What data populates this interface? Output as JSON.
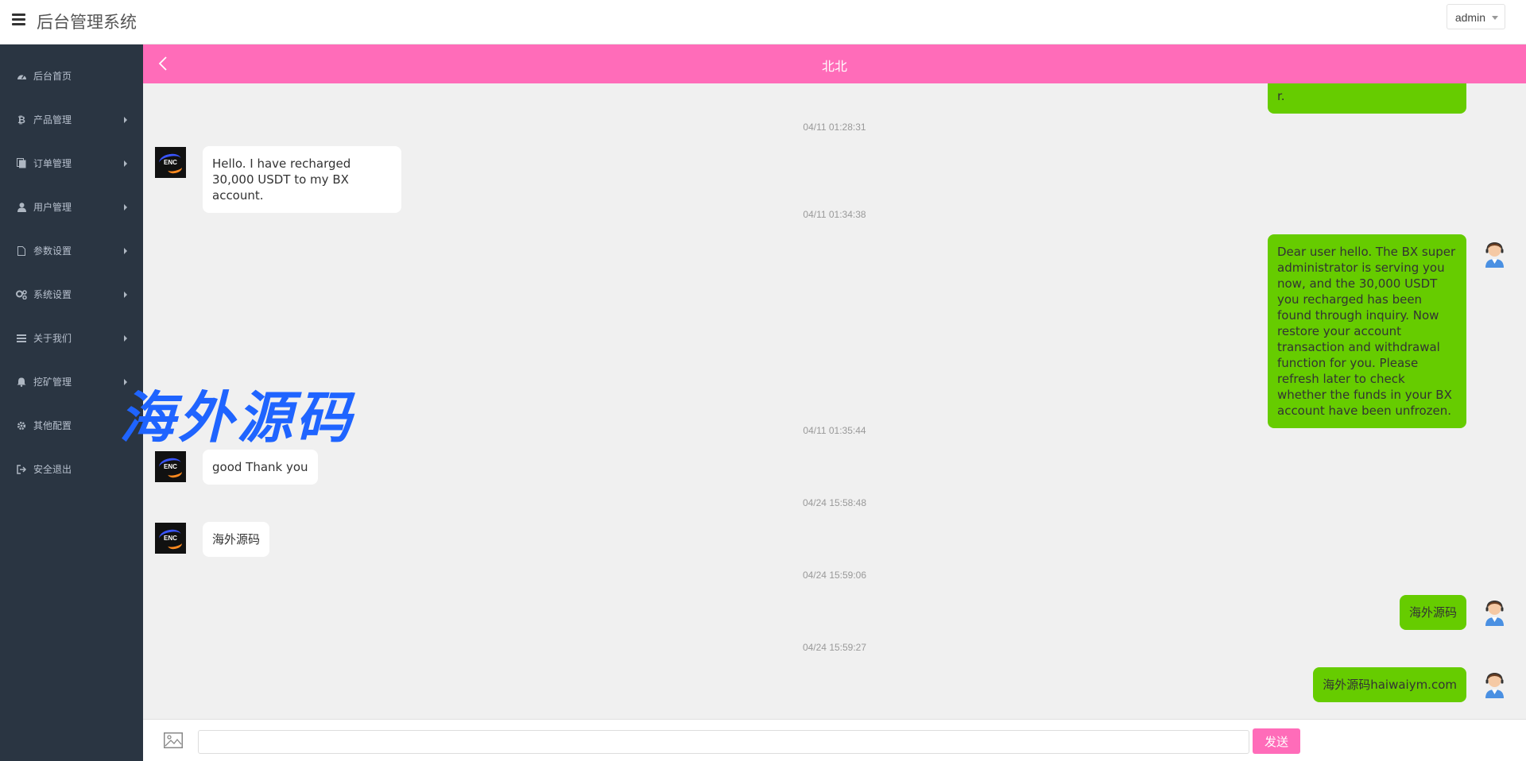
{
  "app": {
    "title": "后台管理系统"
  },
  "header": {
    "user": "admin"
  },
  "sidebar": {
    "items": [
      {
        "label": "后台首页",
        "icon": "dashboard-icon",
        "has_arrow": false
      },
      {
        "label": "产品管理",
        "icon": "bitcoin-icon",
        "has_arrow": true
      },
      {
        "label": "订单管理",
        "icon": "files-icon",
        "has_arrow": true
      },
      {
        "label": "用户管理",
        "icon": "user-icon",
        "has_arrow": true
      },
      {
        "label": "参数设置",
        "icon": "document-icon",
        "has_arrow": true
      },
      {
        "label": "系统设置",
        "icon": "gears-icon",
        "has_arrow": true
      },
      {
        "label": "关于我们",
        "icon": "list-icon",
        "has_arrow": true
      },
      {
        "label": "挖矿管理",
        "icon": "bell-icon",
        "has_arrow": true
      },
      {
        "label": "其他配置",
        "icon": "gear-icon",
        "has_arrow": false
      },
      {
        "label": "安全退出",
        "icon": "sign-out-icon",
        "has_arrow": false
      }
    ]
  },
  "chat": {
    "title": "北北",
    "partial_top_fragment": "r.",
    "messages": [
      {
        "timestamp": "04/11 01:28:31",
        "side": "left",
        "text": "Hello. I have recharged 30,000 USDT to my BX account."
      },
      {
        "timestamp": "04/11 01:34:38",
        "side": "right",
        "text": "Dear user hello. The BX super administrator is serving you now, and the 30,000 USDT you recharged has been found through inquiry. Now restore your account transaction and withdrawal function for you. Please refresh later to check whether the funds in your BX account have been unfrozen."
      },
      {
        "timestamp": "04/11 01:35:44",
        "side": "left",
        "text": "good Thank you"
      },
      {
        "timestamp": "04/24 15:58:48",
        "side": "left",
        "text": "海外源码"
      },
      {
        "timestamp": "04/24 15:59:06",
        "side": "right",
        "text": "海外源码"
      },
      {
        "timestamp": "04/24 15:59:27",
        "side": "right",
        "text": "海外源码haiwaiym.com"
      }
    ],
    "partner_logo_text": "ENC"
  },
  "watermark": {
    "text": "海外源码"
  },
  "composer": {
    "input_value": "",
    "send_label": "发送"
  },
  "colors": {
    "accent": "#ff6cb9",
    "sidebar": "#2a3542",
    "outgoing_bubble": "#66cc00",
    "watermark": "#1f64ff"
  }
}
